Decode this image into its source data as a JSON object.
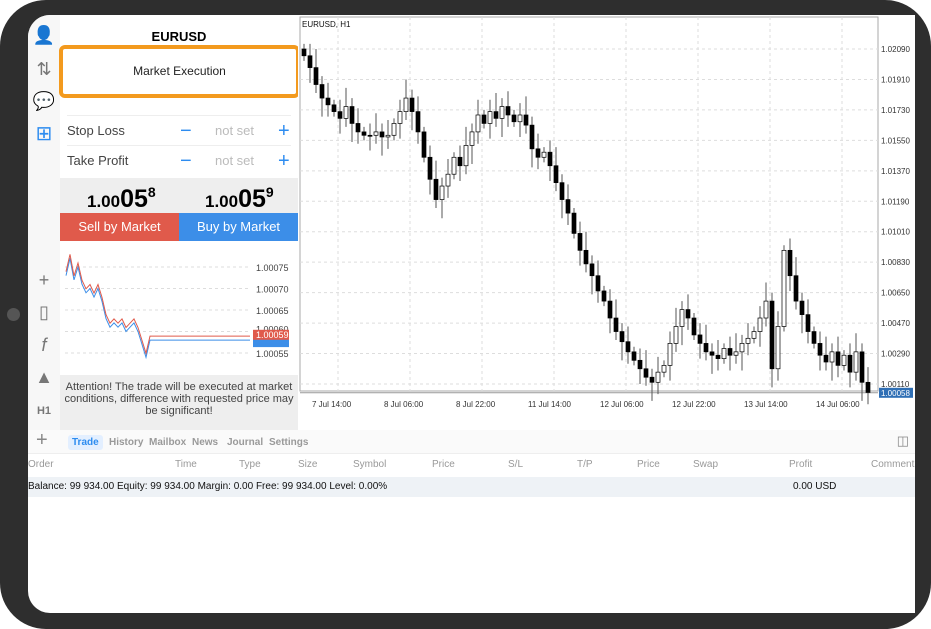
{
  "symbol": "EURUSD",
  "popup": {
    "label": "Market Execution"
  },
  "sidebar_icons": [
    "account-icon",
    "trade-icon",
    "chat-icon",
    "new-order-icon",
    "crosshair-icon",
    "candles-icon",
    "function-icon",
    "objects-icon",
    "timeframe-icon"
  ],
  "timeframe": "H1",
  "order": {
    "stop_loss_label": "Stop Loss",
    "take_profit_label": "Take Profit",
    "sl_value": "not set",
    "tp_value": "not set",
    "minus": "−",
    "plus": "+"
  },
  "prices": {
    "bid_prefix": "1.00",
    "bid_big": "05",
    "bid_sup": "8",
    "ask_prefix": "1.00",
    "ask_big": "05",
    "ask_sup": "9"
  },
  "buttons": {
    "sell": "Sell by Market",
    "buy": "Buy by Market"
  },
  "colors": {
    "sell": "#e05a4b",
    "buy": "#3c8ee8",
    "accent": "#f39a1e"
  },
  "mini_chart": {
    "y_ticks": [
      "1.00075",
      "1.00070",
      "1.00065",
      "1.00060",
      "1.00055"
    ],
    "ask_label": "1.00059",
    "bid_label": "1.00058",
    "bid": [
      1.00073,
      1.00077,
      1.00072,
      1.00075,
      1.00071,
      1.00069,
      1.0007,
      1.00068,
      1.0007,
      1.00067,
      1.00063,
      1.00061,
      1.00062,
      1.00061,
      1.00062,
      1.0006,
      1.00061,
      1.00062,
      1.0006,
      1.00057,
      1.00054,
      1.00058,
      1.00058,
      1.00058
    ]
  },
  "attention": "Attention! The trade will be executed at market conditions, difference with requested price may be significant!",
  "chart": {
    "title": "EURUSD, H1",
    "y_ticks": [
      "1.02090",
      "1.01910",
      "1.01730",
      "1.01550",
      "1.01370",
      "1.01190",
      "1.01010",
      "1.00830",
      "1.00650",
      "1.00470",
      "1.00290",
      "1.00110"
    ],
    "current_price": "1.00058",
    "x_ticks": [
      "7 Jul 14:00",
      "8 Jul 06:00",
      "8 Jul 22:00",
      "11 Jul 14:00",
      "12 Jul 06:00",
      "12 Jul 22:00",
      "13 Jul 14:00",
      "14 Jul 06:00"
    ],
    "closes": [
      1.0205,
      1.0198,
      1.0188,
      1.018,
      1.0176,
      1.0172,
      1.0168,
      1.0175,
      1.0165,
      1.016,
      1.0158,
      1.0158,
      1.016,
      1.0157,
      1.0158,
      1.0165,
      1.0172,
      1.018,
      1.0172,
      1.016,
      1.0145,
      1.0132,
      1.012,
      1.0128,
      1.0135,
      1.0145,
      1.014,
      1.0152,
      1.016,
      1.017,
      1.0165,
      1.0172,
      1.0168,
      1.0175,
      1.017,
      1.0166,
      1.017,
      1.0164,
      1.015,
      1.0145,
      1.0148,
      1.014,
      1.013,
      1.012,
      1.0112,
      1.01,
      1.009,
      1.0082,
      1.0075,
      1.0066,
      1.006,
      1.005,
      1.0042,
      1.0036,
      1.003,
      1.0025,
      1.002,
      1.0015,
      1.0012,
      1.0018,
      1.0022,
      1.0035,
      1.0045,
      1.0055,
      1.005,
      1.004,
      1.0035,
      1.003,
      1.0028,
      1.0026,
      1.0032,
      1.0028,
      1.003,
      1.0035,
      1.0038,
      1.0042,
      1.005,
      1.006,
      1.002,
      1.0045,
      1.009,
      1.0075,
      1.006,
      1.0052,
      1.0042,
      1.0035,
      1.0028,
      1.0024,
      1.003,
      1.0022,
      1.0028,
      1.0018,
      1.003,
      1.0012,
      1.0006
    ]
  },
  "tabs": [
    "Trade",
    "History",
    "Mailbox",
    "News",
    "Journal",
    "Settings"
  ],
  "columns": [
    "Order",
    "Time",
    "Type",
    "Size",
    "Symbol",
    "Price",
    "S/L",
    "T/P",
    "Price",
    "Swap",
    "Profit",
    "Comment"
  ],
  "balance_line": "Balance: 99 934.00 Equity: 99 934.00 Margin: 0.00 Free: 99 934.00 Level: 0.00%",
  "profit_total": "0.00  USD"
}
